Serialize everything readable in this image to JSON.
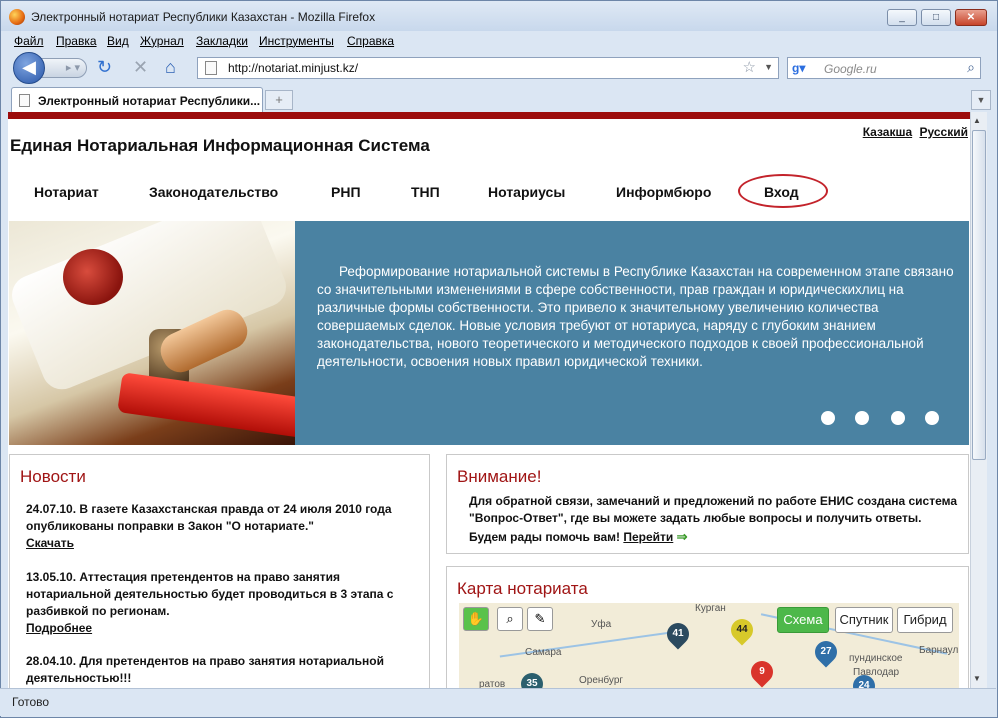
{
  "window": {
    "title": "Электронный нотариат Республики Казахстан - Mozilla Firefox",
    "controls": [
      "_",
      "□",
      "✕"
    ]
  },
  "menu": [
    "Файл",
    "Правка",
    "Вид",
    "Журнал",
    "Закладки",
    "Инструменты",
    "Справка"
  ],
  "nav": {
    "url": "http://notariat.minjust.kz/",
    "search_placeholder": "Google.ru",
    "search_engine_icon": "google-icon"
  },
  "tab": {
    "title": "Электронный нотариат Республики...",
    "new_tab": "+"
  },
  "site": {
    "languages": [
      "Казакша",
      "Русский"
    ],
    "title": "Единая Нотариальная Информационная Система",
    "nav": [
      "Нотариат",
      "Законодательство",
      "РНП",
      "ТНП",
      "Нотариусы",
      "Информбюро",
      "Вход"
    ],
    "highlight_color": "#c3232b",
    "banner_text": "Реформирование нотариальной системы в Республике Казахстан на современном этапе связано со значительными изменениями в сфере собственности, прав граждан и юридическихлиц на различные формы собственности. Это привело к значительному увеличению количества совершаемых сделок. Новые условия требуют от нотариуса, наряду с глубоким знанием законодательства, нового теоретического и методического подходов к своей профессиональной деятельности, освоения новых правил юридической техники.",
    "banner_slides": 4
  },
  "news": {
    "heading": "Новости",
    "items": [
      {
        "text": "24.07.10. В газете Казахстанская правда от 24 июля 2010 года опубликованы поправки в Закон \"О нотариате.\"",
        "link": "Скачать"
      },
      {
        "text": "13.05.10. Аттестация претендентов на право занятия нотариальной деятельностью будет проводиться в 3 этапа с разбивкой по регионам.",
        "link": "Подробнее"
      },
      {
        "text": "28.04.10. Для претендентов на право занятия нотариальной деятельностью!!!",
        "link": ""
      }
    ]
  },
  "attention": {
    "heading": "Внимание!",
    "text": "Для обратной связи, замечаний и предложений по работе ЕНИС создана система \"Вопрос-Ответ\", где вы можете задать любые вопросы и получить ответы.",
    "cta_prefix": "Будем рады помочь вам!",
    "cta_link": "Перейти",
    "arrow": "⇒"
  },
  "map": {
    "heading": "Карта нотариата",
    "types": [
      "Схема",
      "Спутник",
      "Гибрид"
    ],
    "labels": [
      "Курган",
      "Уфа",
      "Самара",
      "Оренбург",
      "Барнаул",
      "Павлодар",
      "ратов",
      "пундинское"
    ],
    "markers": [
      "41",
      "44",
      "27",
      "9",
      "35",
      "24"
    ]
  },
  "status": "Готово"
}
